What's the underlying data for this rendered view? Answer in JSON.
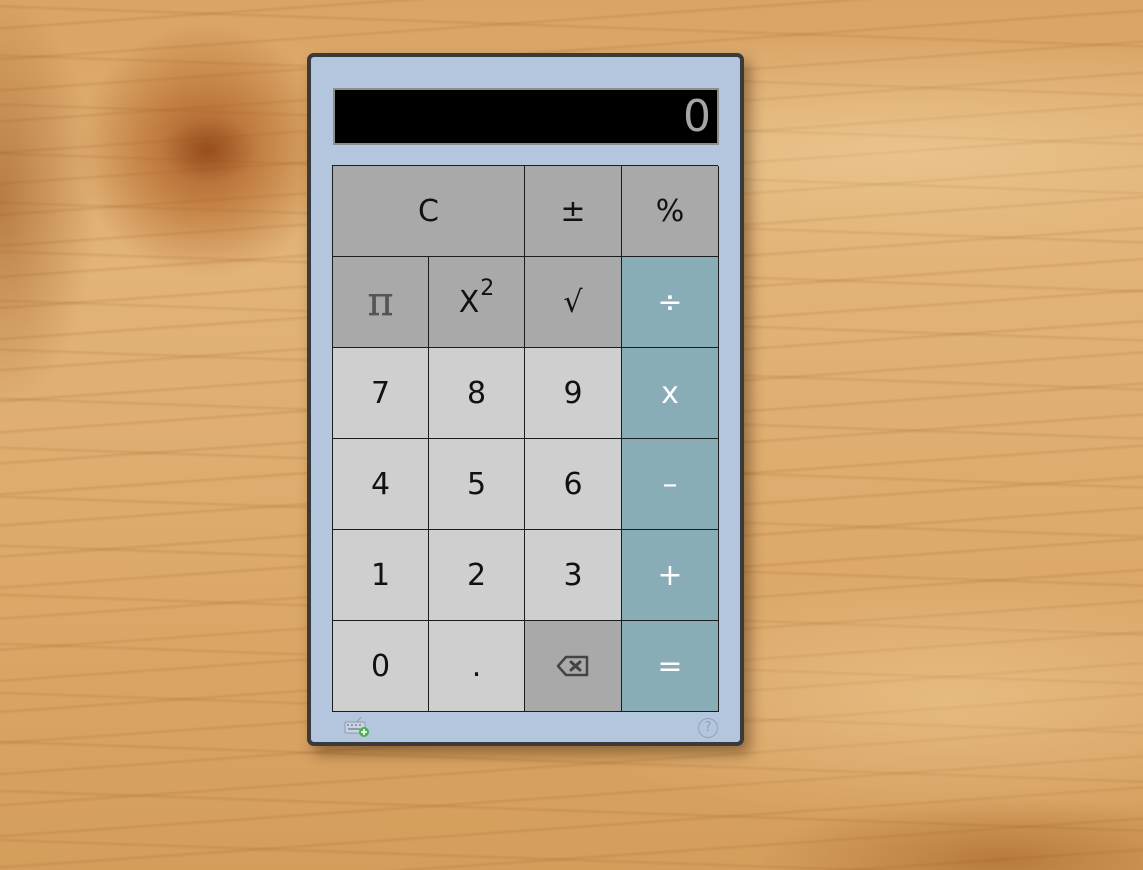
{
  "display": {
    "value": "0"
  },
  "keys": {
    "clear": "C",
    "plus_minus": "±",
    "percent": "%",
    "pi": "π",
    "square_base": "X",
    "square_exp": "2",
    "sqrt": "√",
    "divide": "÷",
    "seven": "7",
    "eight": "8",
    "nine": "9",
    "multiply": "x",
    "four": "4",
    "five": "5",
    "six": "6",
    "subtract": "–",
    "one": "1",
    "two": "2",
    "three": "3",
    "add": "+",
    "zero": "0",
    "decimal": ".",
    "backspace_icon": "backspace-icon",
    "equals": "="
  },
  "footer": {
    "keyboard_icon": "keyboard-add-icon",
    "help_label": "?"
  },
  "colors": {
    "gadget_background": "#b3c6dd",
    "display_background": "#000000",
    "display_text": "#a6a6a6",
    "function_key": "#a9a9a9",
    "number_key": "#cfcfcf",
    "operator_key": "#88adb6"
  }
}
